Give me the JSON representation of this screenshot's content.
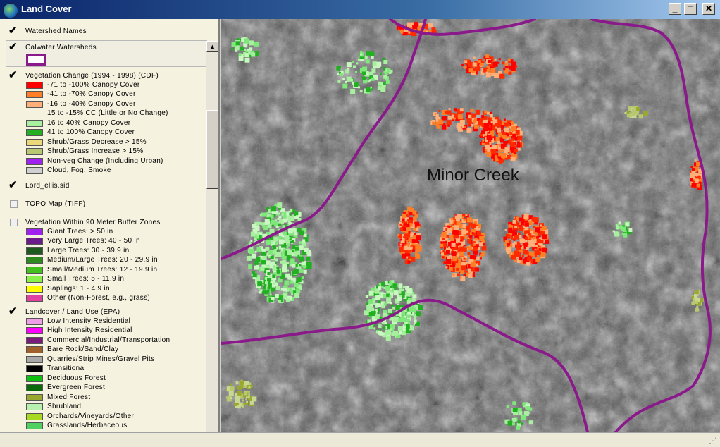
{
  "window": {
    "title": "Land Cover",
    "icon": "globe-icon"
  },
  "legend": {
    "layers": [
      {
        "label": "Watershed Names",
        "checked": true
      },
      {
        "label": "Calwater Watersheds",
        "checked": true
      },
      {
        "label": "Vegetation Change (1994 - 1998) (CDF)",
        "checked": true,
        "classes": [
          {
            "label": "-71 to -100% Canopy Cover",
            "color": "#ff0000"
          },
          {
            "label": "-41 to -70% Canopy Cover",
            "color": "#ff7f27"
          },
          {
            "label": "-16 to -40% Canopy Cover",
            "color": "#ffb07a"
          },
          {
            "label": "15 to -15% CC (Little or No Change)",
            "color": ""
          },
          {
            "label": "16 to 40% Canopy Cover",
            "color": "#a8f0a0"
          },
          {
            "label": "41 to 100% Canopy Cover",
            "color": "#22b022"
          },
          {
            "label": "Shrub/Grass Decrease > 15%",
            "color": "#ecd878"
          },
          {
            "label": "Shrub/Grass Increase > 15%",
            "color": "#b8c870"
          },
          {
            "label": "Non-veg Change (Including Urban)",
            "color": "#a020f0"
          },
          {
            "label": "Cloud, Fog, Smoke",
            "color": "#d0d0d0"
          }
        ]
      },
      {
        "label": "Lord_ellis.sid",
        "checked": true
      },
      {
        "label": "TOPO Map (TIFF)",
        "checked": false
      },
      {
        "label": "Vegetation Within 90 Meter Buffer Zones",
        "checked": false,
        "classes": [
          {
            "label": "Giant Trees: > 50 in",
            "color": "#a020f0"
          },
          {
            "label": "Very Large Trees: 40 - 50 in",
            "color": "#6a1a8a"
          },
          {
            "label": "Large Trees: 30 - 39.9 in",
            "color": "#1e5a1e"
          },
          {
            "label": "Medium/Large Trees: 20 - 29.9 in",
            "color": "#2e8a1e"
          },
          {
            "label": "Small/Medium Trees: 12 - 19.9 in",
            "color": "#44c01e"
          },
          {
            "label": "Small Trees: 5 - 11.9 in",
            "color": "#8af04a"
          },
          {
            "label": "Saplings: 1 - 4.9 in",
            "color": "#ffff00"
          },
          {
            "label": "Other (Non-Forest, e.g., grass)",
            "color": "#e040a0"
          }
        ]
      },
      {
        "label": "Landcover / Land Use (EPA)",
        "checked": true,
        "classes": [
          {
            "label": "Low Intensity Residential",
            "color": "#f0a0e8"
          },
          {
            "label": "High Intensity Residential",
            "color": "#ff00ff"
          },
          {
            "label": "Commercial/Industrial/Transportation",
            "color": "#7a1a7a"
          },
          {
            "label": "Bare Rock/Sand/Clay",
            "color": "#a0602a"
          },
          {
            "label": "Quarries/Strip Mines/Gravel Pits",
            "color": "#a8a8a8"
          },
          {
            "label": "Transitional",
            "color": "#000000"
          },
          {
            "label": "Deciduous Forest",
            "color": "#10c010"
          },
          {
            "label": "Evergreen Forest",
            "color": "#0a6a0a"
          },
          {
            "label": "Mixed Forest",
            "color": "#9aa830"
          },
          {
            "label": "Shrubland",
            "color": "#b8f0b0"
          },
          {
            "label": "Orchards/Vineyards/Other",
            "color": "#a8d820"
          },
          {
            "label": "Grasslands/Herbaceous",
            "color": "#50d060"
          }
        ]
      }
    ]
  },
  "map": {
    "label": "Minor Creek",
    "boundary_color": "#8a1a8a"
  }
}
